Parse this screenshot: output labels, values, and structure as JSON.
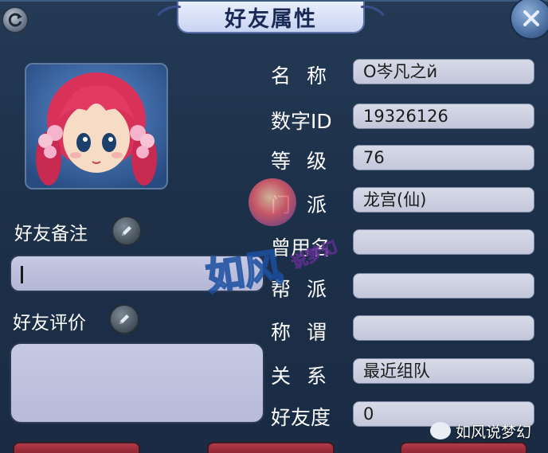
{
  "window": {
    "title": "好友属性"
  },
  "left": {
    "note_label": "好友备注",
    "note_value": "",
    "eval_label": "好友评价",
    "eval_value": ""
  },
  "info_rows": [
    {
      "label": "名 称",
      "value": "O岑凡之й"
    },
    {
      "label": "数字ID",
      "value": "19326126"
    },
    {
      "label": "等 级",
      "value": "76"
    },
    {
      "label": "门 派",
      "value": "龙宫(仙)"
    },
    {
      "label": "曾用名",
      "value": ""
    },
    {
      "label": "帮 派",
      "value": ""
    },
    {
      "label": "称 谓",
      "value": ""
    },
    {
      "label": "关 系",
      "value": "最近组队"
    },
    {
      "label": "好友度",
      "value": "0"
    }
  ],
  "watermark": {
    "main": "如风",
    "sub": "说梦幻",
    "badge": "如风说梦幻"
  },
  "icons": {
    "refresh": "refresh-icon",
    "close": "close-icon",
    "edit": "pencil-icon",
    "badge": "wechat-icon"
  }
}
